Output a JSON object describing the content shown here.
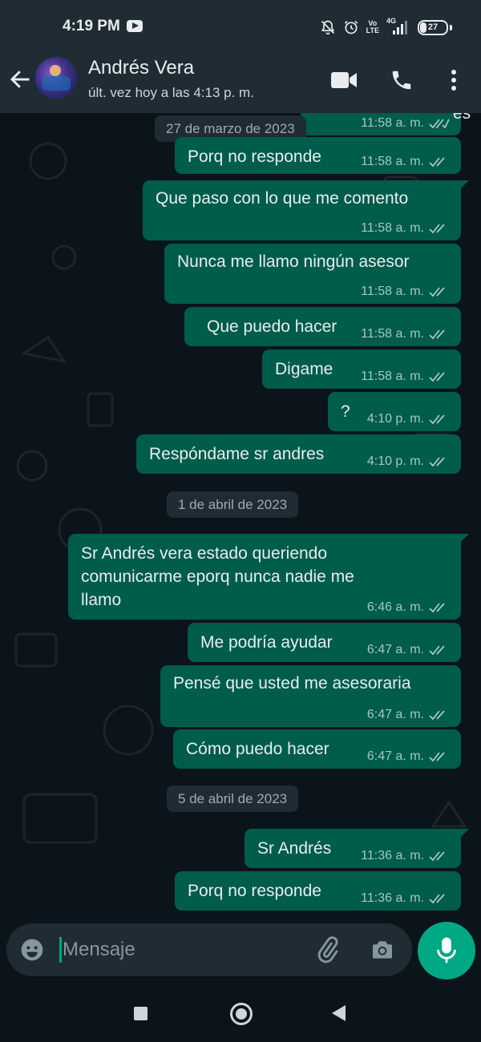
{
  "status_bar": {
    "time": "4:19 PM",
    "volte_line1": "Vo",
    "volte_line2": "LTE",
    "network": "4G",
    "battery": "27",
    "icons": [
      "youtube-icon",
      "mute-bell-icon",
      "alarm-icon",
      "signal-icon",
      "battery-icon"
    ]
  },
  "header": {
    "contact_name": "Andrés Vera",
    "contact_status": "últ. vez hoy a las 4:13 p. m.",
    "icons": [
      "back-arrow-icon",
      "video-call-icon",
      "phone-icon",
      "more-vert-icon"
    ]
  },
  "chat": {
    "top_partial_message": {
      "text": "es",
      "time": "11:58 a. m."
    },
    "dates": [
      "27 de marzo de 2023",
      "1 de abril de 2023",
      "5 de abril de 2023"
    ],
    "messages": [
      {
        "text": "Porq no responde",
        "time": "11:58 a. m."
      },
      {
        "text": "Que paso con lo que me comento",
        "time": "11:58 a. m."
      },
      {
        "text": "Nunca me llamo ningún asesor",
        "time": "11:58 a. m."
      },
      {
        "text": "Que puedo hacer",
        "time": "11:58 a. m."
      },
      {
        "text": "Digame",
        "time": "11:58 a. m."
      },
      {
        "text": "?",
        "time": "4:10 p. m."
      },
      {
        "text": "Respóndame sr andres",
        "time": "4:10 p. m."
      },
      {
        "text": "Sr Andrés vera estado queriendo comunicarme eporq nunca nadie me llamo",
        "lines": [
          "Sr Andrés vera estado queriendo",
          "comunicarme eporq nunca nadie me",
          "llamo"
        ],
        "time": "6:46 a. m."
      },
      {
        "text": "Me podría ayudar",
        "time": "6:47 a. m."
      },
      {
        "text": "Pensé que usted me asesoraria",
        "time": "6:47 a. m."
      },
      {
        "text": "Cómo puedo hacer",
        "time": "6:47 a. m."
      },
      {
        "text": "Sr Andrés",
        "time": "11:36 a. m."
      },
      {
        "text": "Porq no responde",
        "time": "11:36 a. m."
      }
    ],
    "read_status": "read-double-check"
  },
  "input": {
    "placeholder": "Mensaje",
    "value": "",
    "icons": [
      "emoji-icon",
      "attach-icon",
      "camera-icon",
      "mic-icon"
    ]
  },
  "colors": {
    "header_bg": "#1f2c34",
    "chat_bg": "#0b141a",
    "outgoing_bubble": "#005c4b",
    "accent": "#00a884",
    "read_ticks": "#a7c7bf"
  }
}
